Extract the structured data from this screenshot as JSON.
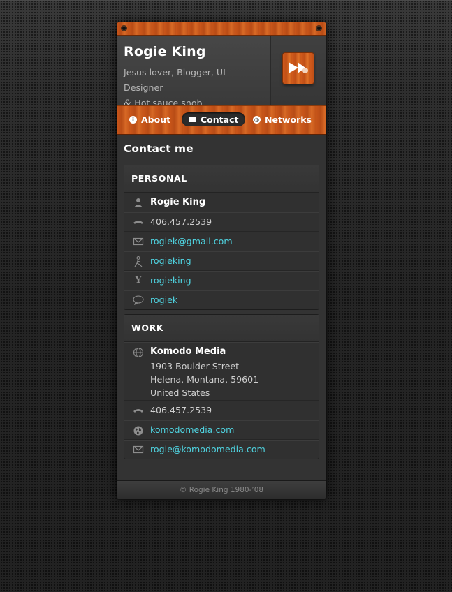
{
  "profile": {
    "name": "Rogie King",
    "tagline_line1": "Jesus lover, Blogger, UI Designer",
    "tagline_amp": "&",
    "tagline_line2": "Hot sauce snob."
  },
  "nav": {
    "items": [
      {
        "label": "About",
        "icon": "info-icon",
        "active": false
      },
      {
        "label": "Contact",
        "icon": "mail-icon",
        "active": true
      },
      {
        "label": "Networks",
        "icon": "globe-icon",
        "active": false
      }
    ]
  },
  "main": {
    "title": "Contact me",
    "personal": {
      "heading": "PERSONAL",
      "rows": [
        {
          "icon": "person-icon",
          "text": "Rogie King",
          "style": "bold"
        },
        {
          "icon": "phone-icon",
          "text": "406.457.2539",
          "style": "plain"
        },
        {
          "icon": "mail-icon",
          "text": "rogiek@gmail.com",
          "style": "link"
        },
        {
          "icon": "aim-icon",
          "text": "rogieking",
          "style": "link"
        },
        {
          "icon": "yahoo-icon",
          "text": "rogieking",
          "style": "link"
        },
        {
          "icon": "chat-bubble-icon",
          "text": "rogiek",
          "style": "link"
        }
      ]
    },
    "work": {
      "heading": "WORK",
      "company": "Komodo Media",
      "address": [
        "1903 Boulder Street",
        "Helena, Montana, 59601",
        "United States"
      ],
      "rows": [
        {
          "icon": "phone-icon",
          "text": "406.457.2539",
          "style": "plain"
        },
        {
          "icon": "globe-icon",
          "text": "komodomedia.com",
          "style": "link"
        },
        {
          "icon": "mail-icon",
          "text": "rogie@komodomedia.com",
          "style": "link"
        }
      ]
    }
  },
  "footer": {
    "copyright": "© Rogie King 1980-’08"
  },
  "colors": {
    "accent_wood": "#c9561a",
    "link": "#4fd3e0",
    "background": "#232323"
  }
}
